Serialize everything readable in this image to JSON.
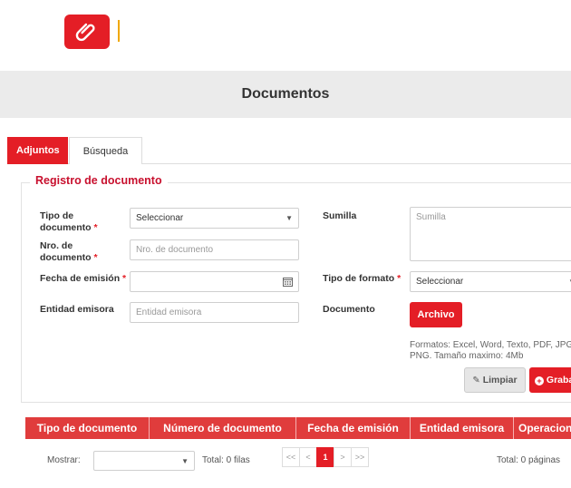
{
  "header": {
    "logo_icon": "paperclip-icon",
    "title": "Documentos"
  },
  "tabs": [
    {
      "label": "Adjuntos",
      "active": true
    },
    {
      "label": "Búsqueda",
      "active": false
    }
  ],
  "form": {
    "legend": "Registro de documento",
    "tipo_documento": {
      "label_line1": "Tipo de",
      "label_line2": "documento",
      "required": "*",
      "value": "Seleccionar"
    },
    "nro_documento": {
      "label_line1": "Nro. de",
      "label_line2": "documento",
      "required": "*",
      "placeholder": "Nro. de documento"
    },
    "fecha_emision": {
      "label": "Fecha de emisión",
      "required": "*",
      "value": ""
    },
    "entidad_emisora": {
      "label": "Entidad emisora",
      "placeholder": "Entidad emisora"
    },
    "sumilla": {
      "label": "Sumilla",
      "placeholder": "Sumilla"
    },
    "tipo_formato": {
      "label": "Tipo de formato",
      "required": "*",
      "value": "Seleccionar"
    },
    "documento": {
      "label": "Documento",
      "button": "Archivo"
    },
    "hint": "Formatos: Excel, Word, Texto, PDF, JPG, PNG. Tamaño maximo: 4Mb",
    "limpiar": "Limpiar",
    "grabar": "Grabar"
  },
  "table": {
    "columns": [
      "Tipo de documento",
      "Número de documento",
      "Fecha de emisión",
      "Entidad emisora",
      "Operaciones"
    ]
  },
  "footer": {
    "mostrar_label": "Mostrar:",
    "mostrar_value": "",
    "total_filas": "Total: 0 filas",
    "pager": [
      "<<",
      "<",
      "1",
      ">",
      ">>"
    ],
    "current_page": "1",
    "total_paginas": "Total: 0 páginas"
  },
  "colors": {
    "accent": "#e41e26",
    "header_bg": "#ebebeb",
    "table_header": "#e03c3c"
  }
}
